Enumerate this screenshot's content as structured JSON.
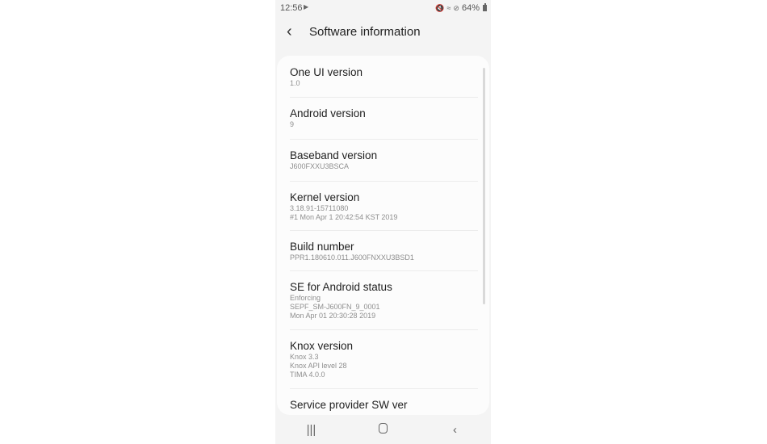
{
  "status_bar": {
    "time": "12:56",
    "left_icons": [
      "play-store-notification-icon"
    ],
    "right_icons": [
      "mute-icon",
      "wifi-icon",
      "do-not-disturb-icon"
    ],
    "battery_percent": "64%"
  },
  "header": {
    "back_icon": "chevron-left-icon",
    "title": "Software information"
  },
  "items": [
    {
      "title": "One UI version",
      "lines": [
        "1.0"
      ]
    },
    {
      "title": "Android version",
      "lines": [
        "9"
      ]
    },
    {
      "title": "Baseband version",
      "lines": [
        "J600FXXU3BSCA"
      ]
    },
    {
      "title": "Kernel version",
      "lines": [
        "3.18.91-15711080",
        "#1 Mon Apr 1 20:42:54 KST 2019"
      ]
    },
    {
      "title": "Build number",
      "lines": [
        "PPR1.180610.011.J600FNXXU3BSD1"
      ]
    },
    {
      "title": "SE for Android status",
      "lines": [
        "Enforcing",
        "SEPF_SM-J600FN_9_0001",
        "Mon Apr 01 20:30:28 2019"
      ]
    },
    {
      "title": "Knox version",
      "lines": [
        "Knox 3.3",
        "Knox API level 28",
        "TIMA 4.0.0"
      ]
    },
    {
      "title": "Service provider SW ver",
      "lines": []
    }
  ],
  "nav_bar": {
    "recents_icon": "recents-icon",
    "home_icon": "home-icon",
    "back_icon": "back-icon"
  }
}
